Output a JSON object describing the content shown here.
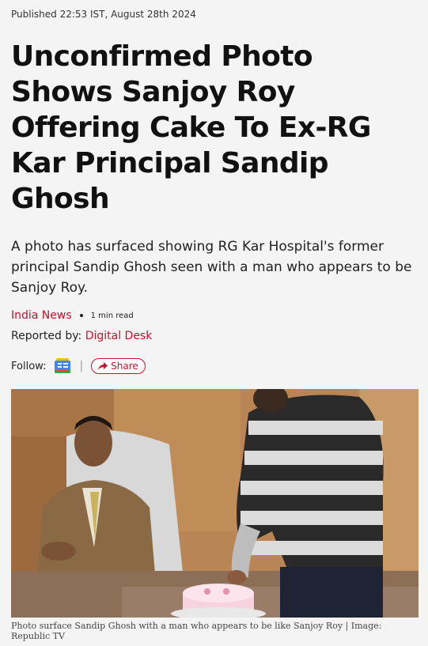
{
  "article": {
    "published": "Published 22:53 IST, August 28th 2024",
    "headline_lines": [
      "Unconfirmed Photo",
      "Shows Sanjoy Roy",
      "Offering Cake To Ex-RG",
      "Kar Principal Sandip",
      "Ghosh"
    ],
    "summary": "A photo has surfaced showing RG Kar Hospital's former principal Sandip Ghosh seen with a man who appears to be Sanjoy Roy.",
    "category": "India News",
    "read_time": "1 min read",
    "reported_by_label": "Reported by: ",
    "author": "Digital Desk",
    "follow_label": "Follow:",
    "separator": "|",
    "share_label": "Share",
    "caption": "Photo surface Sandip Ghosh with a man who appears to be like Sanjoy Roy | Image: Republic TV"
  },
  "icons": {
    "google_news": "google-news-icon",
    "share": "share-arrow-icon"
  },
  "colors": {
    "accent": "#c8102e",
    "background": "#f4f4f4",
    "text": "#111111"
  }
}
